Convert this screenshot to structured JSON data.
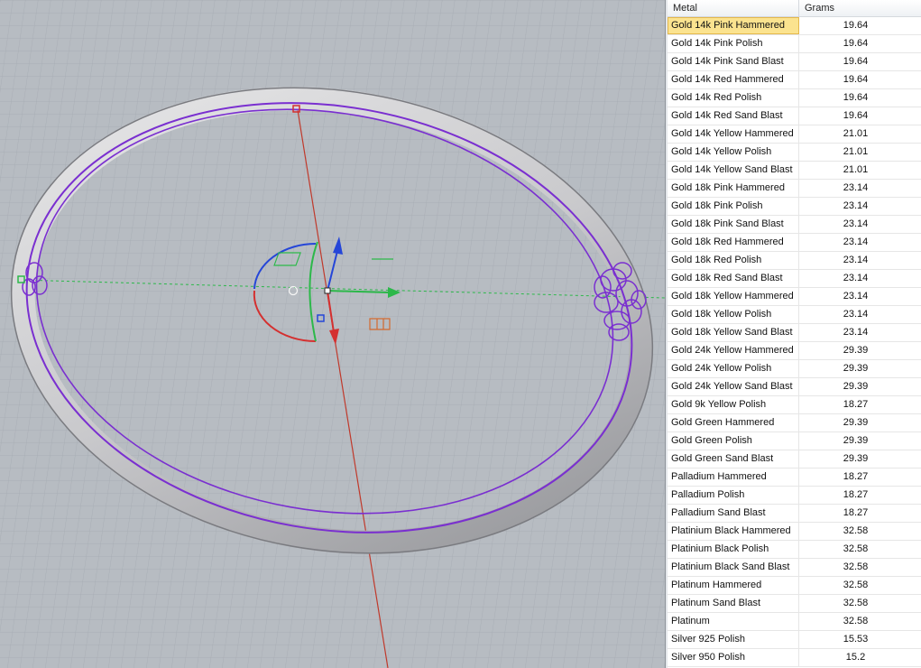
{
  "table": {
    "headers": {
      "metal": "Metal",
      "grams": "Grams"
    },
    "selected_index": 0,
    "rows": [
      {
        "metal": "Gold 14k Pink Hammered",
        "grams": "19.64"
      },
      {
        "metal": "Gold 14k Pink Polish",
        "grams": "19.64"
      },
      {
        "metal": "Gold 14k Pink Sand Blast",
        "grams": "19.64"
      },
      {
        "metal": "Gold 14k Red Hammered",
        "grams": "19.64"
      },
      {
        "metal": "Gold 14k Red Polish",
        "grams": "19.64"
      },
      {
        "metal": "Gold 14k Red Sand Blast",
        "grams": "19.64"
      },
      {
        "metal": "Gold 14k Yellow Hammered",
        "grams": "21.01"
      },
      {
        "metal": "Gold 14k Yellow Polish",
        "grams": "21.01"
      },
      {
        "metal": "Gold 14k Yellow Sand Blast",
        "grams": "21.01"
      },
      {
        "metal": "Gold 18k Pink Hammered",
        "grams": "23.14"
      },
      {
        "metal": "Gold 18k Pink Polish",
        "grams": "23.14"
      },
      {
        "metal": "Gold 18k Pink Sand Blast",
        "grams": "23.14"
      },
      {
        "metal": "Gold 18k Red Hammered",
        "grams": "23.14"
      },
      {
        "metal": "Gold 18k Red Polish",
        "grams": "23.14"
      },
      {
        "metal": "Gold 18k Red Sand Blast",
        "grams": "23.14"
      },
      {
        "metal": "Gold 18k Yellow Hammered",
        "grams": "23.14"
      },
      {
        "metal": "Gold 18k Yellow Polish",
        "grams": "23.14"
      },
      {
        "metal": "Gold 18k Yellow Sand Blast",
        "grams": "23.14"
      },
      {
        "metal": "Gold 24k Yellow Hammered",
        "grams": "29.39"
      },
      {
        "metal": "Gold 24k Yellow Polish",
        "grams": "29.39"
      },
      {
        "metal": "Gold 24k Yellow Sand Blast",
        "grams": "29.39"
      },
      {
        "metal": "Gold 9k Yellow Polish",
        "grams": "18.27"
      },
      {
        "metal": "Gold Green Hammered",
        "grams": "29.39"
      },
      {
        "metal": "Gold Green Polish",
        "grams": "29.39"
      },
      {
        "metal": "Gold Green Sand Blast",
        "grams": "29.39"
      },
      {
        "metal": "Palladium Hammered",
        "grams": "18.27"
      },
      {
        "metal": "Palladium Polish",
        "grams": "18.27"
      },
      {
        "metal": "Palladium Sand Blast",
        "grams": "18.27"
      },
      {
        "metal": "Platinium Black Hammered",
        "grams": "32.58"
      },
      {
        "metal": "Platinium Black Polish",
        "grams": "32.58"
      },
      {
        "metal": "Platinium Black Sand Blast",
        "grams": "32.58"
      },
      {
        "metal": "Platinum Hammered",
        "grams": "32.58"
      },
      {
        "metal": "Platinum Sand Blast",
        "grams": "32.58"
      },
      {
        "metal": "Platinum",
        "grams": "32.58"
      },
      {
        "metal": "Silver 925 Polish",
        "grams": "15.53"
      },
      {
        "metal": "Silver 950 Polish",
        "grams": "15.2"
      }
    ]
  },
  "colors": {
    "viewport_bg": "#b7bcc2",
    "grid_line": "#a9aeb5",
    "curve": "#7a2fd0",
    "x_axis": "#c0392b",
    "y_axis": "#27ae3a",
    "z_axis": "#2546d8",
    "selection": "#fbe38f"
  }
}
